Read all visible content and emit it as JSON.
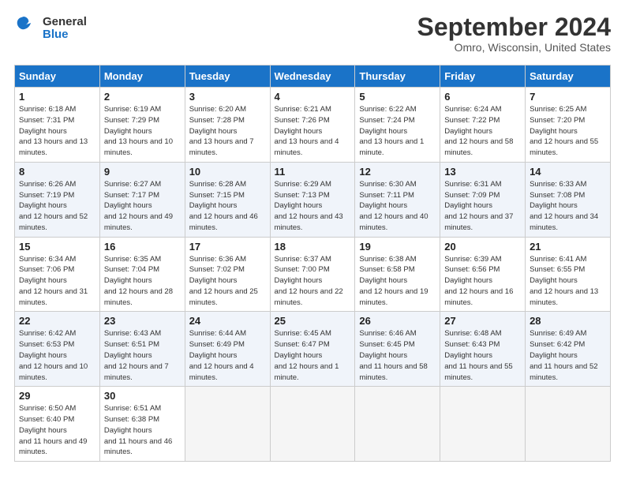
{
  "header": {
    "logo_general": "General",
    "logo_blue": "Blue",
    "title": "September 2024",
    "location": "Omro, Wisconsin, United States"
  },
  "days_of_week": [
    "Sunday",
    "Monday",
    "Tuesday",
    "Wednesday",
    "Thursday",
    "Friday",
    "Saturday"
  ],
  "weeks": [
    [
      {
        "day": "1",
        "sunrise": "6:18 AM",
        "sunset": "7:31 PM",
        "daylight": "13 hours and 13 minutes."
      },
      {
        "day": "2",
        "sunrise": "6:19 AM",
        "sunset": "7:29 PM",
        "daylight": "13 hours and 10 minutes."
      },
      {
        "day": "3",
        "sunrise": "6:20 AM",
        "sunset": "7:28 PM",
        "daylight": "13 hours and 7 minutes."
      },
      {
        "day": "4",
        "sunrise": "6:21 AM",
        "sunset": "7:26 PM",
        "daylight": "13 hours and 4 minutes."
      },
      {
        "day": "5",
        "sunrise": "6:22 AM",
        "sunset": "7:24 PM",
        "daylight": "13 hours and 1 minute."
      },
      {
        "day": "6",
        "sunrise": "6:24 AM",
        "sunset": "7:22 PM",
        "daylight": "12 hours and 58 minutes."
      },
      {
        "day": "7",
        "sunrise": "6:25 AM",
        "sunset": "7:20 PM",
        "daylight": "12 hours and 55 minutes."
      }
    ],
    [
      {
        "day": "8",
        "sunrise": "6:26 AM",
        "sunset": "7:19 PM",
        "daylight": "12 hours and 52 minutes."
      },
      {
        "day": "9",
        "sunrise": "6:27 AM",
        "sunset": "7:17 PM",
        "daylight": "12 hours and 49 minutes."
      },
      {
        "day": "10",
        "sunrise": "6:28 AM",
        "sunset": "7:15 PM",
        "daylight": "12 hours and 46 minutes."
      },
      {
        "day": "11",
        "sunrise": "6:29 AM",
        "sunset": "7:13 PM",
        "daylight": "12 hours and 43 minutes."
      },
      {
        "day": "12",
        "sunrise": "6:30 AM",
        "sunset": "7:11 PM",
        "daylight": "12 hours and 40 minutes."
      },
      {
        "day": "13",
        "sunrise": "6:31 AM",
        "sunset": "7:09 PM",
        "daylight": "12 hours and 37 minutes."
      },
      {
        "day": "14",
        "sunrise": "6:33 AM",
        "sunset": "7:08 PM",
        "daylight": "12 hours and 34 minutes."
      }
    ],
    [
      {
        "day": "15",
        "sunrise": "6:34 AM",
        "sunset": "7:06 PM",
        "daylight": "12 hours and 31 minutes."
      },
      {
        "day": "16",
        "sunrise": "6:35 AM",
        "sunset": "7:04 PM",
        "daylight": "12 hours and 28 minutes."
      },
      {
        "day": "17",
        "sunrise": "6:36 AM",
        "sunset": "7:02 PM",
        "daylight": "12 hours and 25 minutes."
      },
      {
        "day": "18",
        "sunrise": "6:37 AM",
        "sunset": "7:00 PM",
        "daylight": "12 hours and 22 minutes."
      },
      {
        "day": "19",
        "sunrise": "6:38 AM",
        "sunset": "6:58 PM",
        "daylight": "12 hours and 19 minutes."
      },
      {
        "day": "20",
        "sunrise": "6:39 AM",
        "sunset": "6:56 PM",
        "daylight": "12 hours and 16 minutes."
      },
      {
        "day": "21",
        "sunrise": "6:41 AM",
        "sunset": "6:55 PM",
        "daylight": "12 hours and 13 minutes."
      }
    ],
    [
      {
        "day": "22",
        "sunrise": "6:42 AM",
        "sunset": "6:53 PM",
        "daylight": "12 hours and 10 minutes."
      },
      {
        "day": "23",
        "sunrise": "6:43 AM",
        "sunset": "6:51 PM",
        "daylight": "12 hours and 7 minutes."
      },
      {
        "day": "24",
        "sunrise": "6:44 AM",
        "sunset": "6:49 PM",
        "daylight": "12 hours and 4 minutes."
      },
      {
        "day": "25",
        "sunrise": "6:45 AM",
        "sunset": "6:47 PM",
        "daylight": "12 hours and 1 minute."
      },
      {
        "day": "26",
        "sunrise": "6:46 AM",
        "sunset": "6:45 PM",
        "daylight": "11 hours and 58 minutes."
      },
      {
        "day": "27",
        "sunrise": "6:48 AM",
        "sunset": "6:43 PM",
        "daylight": "11 hours and 55 minutes."
      },
      {
        "day": "28",
        "sunrise": "6:49 AM",
        "sunset": "6:42 PM",
        "daylight": "11 hours and 52 minutes."
      }
    ],
    [
      {
        "day": "29",
        "sunrise": "6:50 AM",
        "sunset": "6:40 PM",
        "daylight": "11 hours and 49 minutes."
      },
      {
        "day": "30",
        "sunrise": "6:51 AM",
        "sunset": "6:38 PM",
        "daylight": "11 hours and 46 minutes."
      },
      null,
      null,
      null,
      null,
      null
    ]
  ]
}
